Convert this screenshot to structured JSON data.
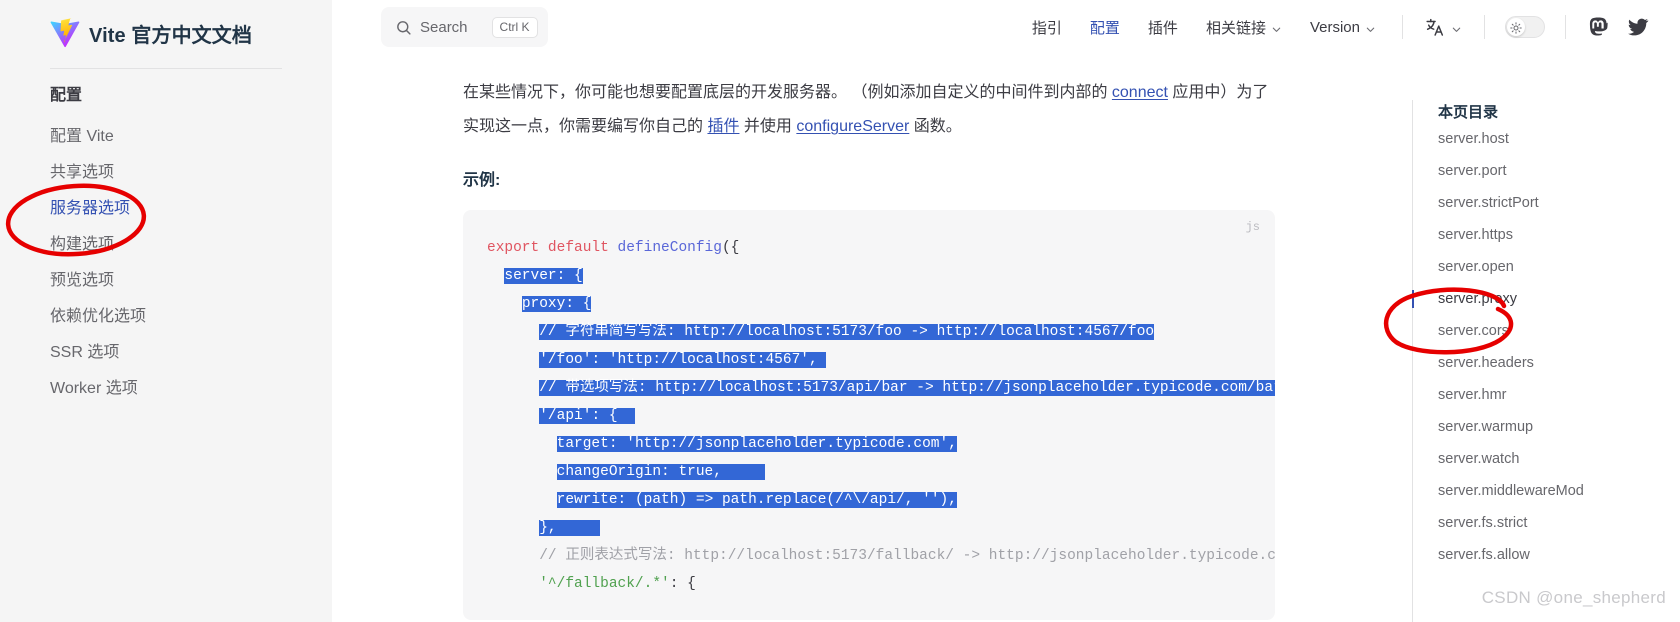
{
  "sidebar": {
    "brand_title": "Vite 官方中文文档",
    "group_title": "配置",
    "items": [
      {
        "label": "配置 Vite",
        "active": false
      },
      {
        "label": "共享选项",
        "active": false
      },
      {
        "label": "服务器选项",
        "active": true
      },
      {
        "label": "构建选项",
        "active": false
      },
      {
        "label": "预览选项",
        "active": false
      },
      {
        "label": "依赖优化选项",
        "active": false
      },
      {
        "label": "SSR 选项",
        "active": false
      },
      {
        "label": "Worker 选项",
        "active": false
      }
    ]
  },
  "topnav": {
    "search": {
      "label": "Search",
      "kbd": "Ctrl K",
      "icon": "search-icon"
    },
    "links": [
      {
        "label": "指引",
        "active": false,
        "chevron": false
      },
      {
        "label": "配置",
        "active": true,
        "chevron": false
      },
      {
        "label": "插件",
        "active": false,
        "chevron": false
      },
      {
        "label": "相关链接",
        "active": false,
        "chevron": true
      },
      {
        "label": "Version",
        "active": false,
        "chevron": true
      }
    ],
    "i18n": {
      "icon": "translate-icon",
      "chevron": true
    },
    "theme_toggle": {
      "icon": "sun-icon",
      "state": "light"
    },
    "social": [
      {
        "icon": "mastodon-icon"
      },
      {
        "icon": "twitter-icon"
      }
    ]
  },
  "main": {
    "paragraph_parts": [
      {
        "text": "在某些情况下，你可能也想要配置底层的开发服务器。 （例如添加自定义的中间件到内部的 ",
        "link": false
      },
      {
        "text": "connect",
        "link": true
      },
      {
        "text": " 应用中）为了实现这一点，你需要编写你自己的 ",
        "link": false
      },
      {
        "text": "插件",
        "link": true
      },
      {
        "text": " 并使用 ",
        "link": false
      },
      {
        "text": "configureServer",
        "link": true
      },
      {
        "text": " 函数。",
        "link": false
      }
    ],
    "example_heading": "示例:",
    "code": {
      "lang_label": "js",
      "lines": [
        "export default defineConfig({",
        "  server: {",
        "    proxy: {",
        "      // 字符串简写写法: http://localhost:5173/foo -> http://localhost:4567/foo",
        "      '/foo': 'http://localhost:4567',",
        "      // 带选项写法: http://localhost:5173/api/bar -> http://jsonplaceholder.typicode.com/bar",
        "      '/api': {",
        "        target: 'http://jsonplaceholder.typicode.com',",
        "        changeOrigin: true,",
        "        rewrite: (path) => path.replace(/^\\/api/, ''),",
        "      },",
        "      // 正则表达式写法: http://localhost:5173/fallback/ -> http://jsonplaceholder.typicode.com/",
        "      '^/fallback/.*': {"
      ]
    }
  },
  "toc": {
    "title": "本页目录",
    "items": [
      {
        "label": "server.host",
        "active": false
      },
      {
        "label": "server.port",
        "active": false
      },
      {
        "label": "server.strictPort",
        "active": false
      },
      {
        "label": "server.https",
        "active": false
      },
      {
        "label": "server.open",
        "active": false
      },
      {
        "label": "server.proxy",
        "active": true
      },
      {
        "label": "server.cors",
        "active": false
      },
      {
        "label": "server.headers",
        "active": false
      },
      {
        "label": "server.hmr",
        "active": false
      },
      {
        "label": "server.warmup",
        "active": false
      },
      {
        "label": "server.watch",
        "active": false
      },
      {
        "label": "server.middlewareMod",
        "active": false
      },
      {
        "label": "server.fs.strict",
        "active": false
      },
      {
        "label": "server.fs.allow",
        "active": false
      }
    ]
  },
  "watermark": "CSDN @one_shepherd",
  "colors": {
    "accent": "#3451b2",
    "selection": "#3367d6",
    "annotation": "#e60000",
    "sidebar_bg": "#f5f5f5",
    "code_bg": "#f6f6f7"
  }
}
